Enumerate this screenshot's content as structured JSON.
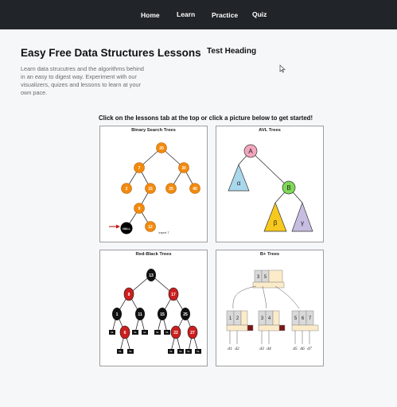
{
  "nav": {
    "home": "Home",
    "learn": "Learn",
    "practice": "Practice",
    "quiz": "Quiz"
  },
  "hero": {
    "title": "Easy Free Data Structures Lessons",
    "description": "Learn data strucutres and the algorithms behind in an easy to digest way. Experiment with our visualizers, quizes and lessons to learn at your own pace."
  },
  "test_heading": "Test Heading",
  "instructions": "Click on the lessons tab at the top or click a picture below to get started!",
  "cards": [
    {
      "title": "Binary Search Trees",
      "nodes": [
        "20",
        "7",
        "30",
        "2",
        "15",
        "25",
        "40",
        "9",
        "12"
      ],
      "null_label": "NULL",
      "insert_label": "insert 7"
    },
    {
      "title": "AVL Trees",
      "node_a": "A",
      "node_b": "B",
      "subtrees": [
        "α",
        "β",
        "γ"
      ]
    },
    {
      "title": "Red-Black Trees",
      "root": "13",
      "level1": [
        "8",
        "17"
      ],
      "level2": [
        "1",
        "11",
        "15",
        "25"
      ],
      "level3": [
        "6",
        "22",
        "27"
      ],
      "nil_label": "NIL"
    },
    {
      "title": "B+ Trees",
      "root_keys": [
        "3",
        "5"
      ],
      "leaves": [
        [
          "1",
          "2"
        ],
        [
          "3",
          "4"
        ],
        [
          "5",
          "6",
          "7"
        ]
      ],
      "data_labels": [
        "d1",
        "d2",
        "d3",
        "d4",
        "d5",
        "d6",
        "d7"
      ]
    }
  ],
  "colors": {
    "navbar": "#212529",
    "bst_node": "#f28a0e",
    "rb_red": "#cc1f1f",
    "rb_black": "#111111",
    "avl_pink": "#f3a6bd",
    "avl_green": "#7ed957",
    "avl_blue": "#a9d8ec",
    "avl_yellow": "#f7c81e",
    "avl_purple": "#c6bde0",
    "arrow_red": "#c21818"
  }
}
